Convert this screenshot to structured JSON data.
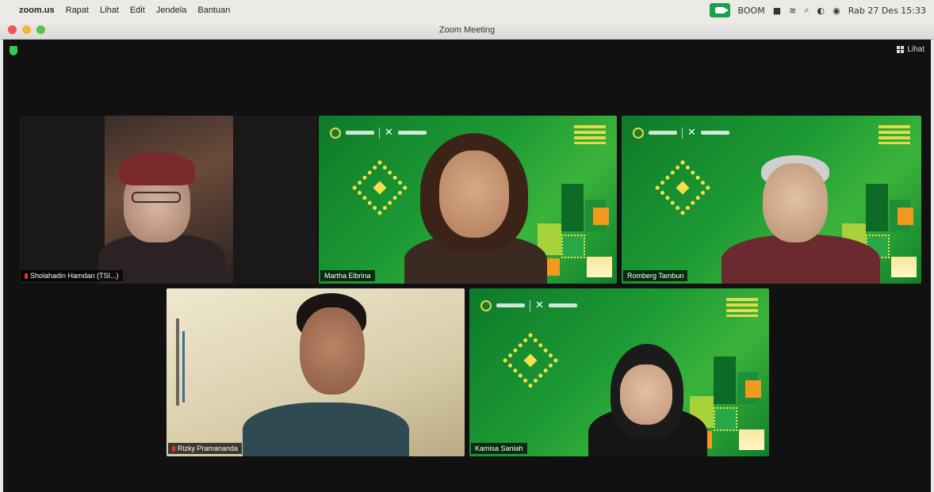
{
  "menubar": {
    "apple_symbol": "",
    "app_name": "zoom.us",
    "items": [
      "Rapat",
      "Lihat",
      "Edit",
      "Jendela",
      "Bantuan"
    ],
    "status_items": [
      "BOOM",
      "■",
      "≋",
      "⌕",
      "◐",
      "◉"
    ],
    "datetime": "Rab 27 Des 15:33"
  },
  "window": {
    "title": "Zoom Meeting"
  },
  "meeting": {
    "view_label": "Lihat",
    "accent_color": "#2ecc52",
    "participants": [
      {
        "name": "Sholahadin Hamdan (TSI...)",
        "muted": true,
        "background": "webcam"
      },
      {
        "name": "Martha Elbrina",
        "muted": false,
        "background": "virtual-green"
      },
      {
        "name": "Romberg Tambun",
        "muted": false,
        "background": "virtual-green"
      },
      {
        "name": "Rizky Pramananda",
        "muted": true,
        "background": "webcam"
      },
      {
        "name": "Kamisa Saniah",
        "muted": false,
        "background": "virtual-green"
      }
    ]
  }
}
